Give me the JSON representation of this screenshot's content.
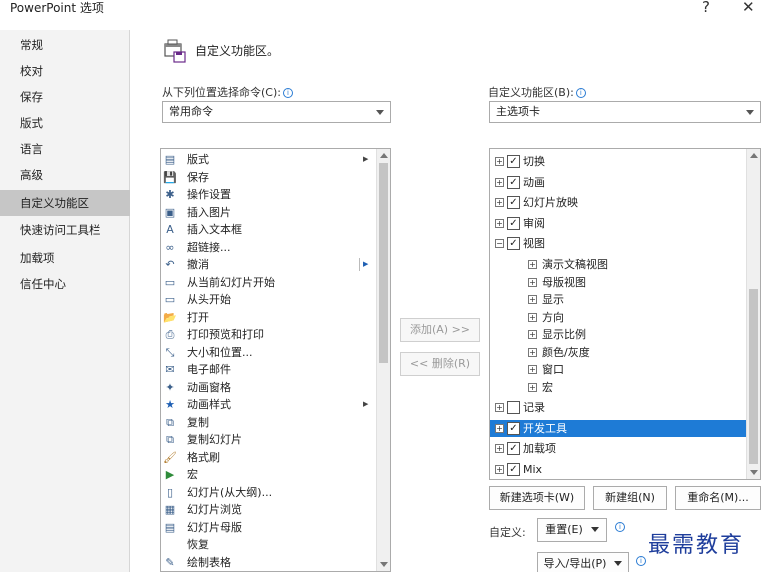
{
  "window": {
    "title": "PowerPoint 选项",
    "help_glyph": "?",
    "close_glyph": "✕"
  },
  "sidebar": {
    "items": [
      {
        "label": "常规",
        "selected": false
      },
      {
        "label": "校对",
        "selected": false
      },
      {
        "label": "保存",
        "selected": false
      },
      {
        "label": "版式",
        "selected": false
      },
      {
        "label": "语言",
        "selected": false
      },
      {
        "label": "高级",
        "selected": false
      },
      {
        "label": "自定义功能区",
        "selected": true
      },
      {
        "label": "快速访问工具栏",
        "selected": false
      },
      {
        "label": "加载项",
        "selected": false
      },
      {
        "label": "信任中心",
        "selected": false
      }
    ]
  },
  "header": {
    "title": "自定义功能区。",
    "icon": "customize-ribbon-icon"
  },
  "left_panel": {
    "label": "从下列位置选择命令(C):",
    "dropdown_value": "常用命令",
    "commands": [
      {
        "label": "版式",
        "icon": "layout-icon",
        "glyph": "▤",
        "submenu": true
      },
      {
        "label": "保存",
        "icon": "save-icon",
        "glyph": "💾",
        "submenu": false
      },
      {
        "label": "操作设置",
        "icon": "action-icon",
        "glyph": "✱",
        "submenu": false
      },
      {
        "label": "插入图片",
        "icon": "picture-icon",
        "glyph": "▣",
        "submenu": false
      },
      {
        "label": "插入文本框",
        "icon": "textbox-icon",
        "glyph": "A",
        "submenu": false
      },
      {
        "label": "超链接...",
        "icon": "link-icon",
        "glyph": "∞",
        "submenu": false
      },
      {
        "label": "撤消",
        "icon": "undo-icon",
        "glyph": "↶",
        "submenu": true,
        "split": true
      },
      {
        "label": "从当前幻灯片开始",
        "icon": "slideshow-current-icon",
        "glyph": "▭",
        "submenu": false
      },
      {
        "label": "从头开始",
        "icon": "slideshow-start-icon",
        "glyph": "▭",
        "submenu": false
      },
      {
        "label": "打开",
        "icon": "open-folder-icon",
        "glyph": "📂",
        "submenu": false
      },
      {
        "label": "打印预览和打印",
        "icon": "print-preview-icon",
        "glyph": "⎙",
        "submenu": false
      },
      {
        "label": "大小和位置...",
        "icon": "size-position-icon",
        "glyph": "⤡",
        "submenu": false
      },
      {
        "label": "电子邮件",
        "icon": "email-icon",
        "glyph": "✉",
        "submenu": false
      },
      {
        "label": "动画窗格",
        "icon": "animation-pane-icon",
        "glyph": "✦",
        "submenu": false
      },
      {
        "label": "动画样式",
        "icon": "animation-style-icon",
        "glyph": "★",
        "submenu": true
      },
      {
        "label": "复制",
        "icon": "copy-icon",
        "glyph": "⧉",
        "submenu": false
      },
      {
        "label": "复制幻灯片",
        "icon": "duplicate-slide-icon",
        "glyph": "⧉",
        "submenu": false
      },
      {
        "label": "格式刷",
        "icon": "format-painter-icon",
        "glyph": "🖌",
        "submenu": false
      },
      {
        "label": "宏",
        "icon": "macro-icon",
        "glyph": "▶",
        "submenu": false
      },
      {
        "label": "幻灯片(从大纲)...",
        "icon": "slides-outline-icon",
        "glyph": "▯",
        "submenu": false
      },
      {
        "label": "幻灯片浏览",
        "icon": "slide-sorter-icon",
        "glyph": "▦",
        "submenu": false
      },
      {
        "label": "幻灯片母版",
        "icon": "slide-master-icon",
        "glyph": "▤",
        "submenu": false
      },
      {
        "label": "恢复",
        "icon": "redo-icon",
        "glyph": "",
        "submenu": false
      },
      {
        "label": "绘制表格",
        "icon": "draw-table-icon",
        "glyph": "✎",
        "submenu": false
      }
    ]
  },
  "middle": {
    "add_label": "添加(A) >>",
    "remove_label": "<< 删除(R)"
  },
  "right_panel": {
    "label": "自定义功能区(B):",
    "dropdown_value": "主选项卡",
    "tree": [
      {
        "label": "切换",
        "level": 0,
        "expander": "+",
        "checked": true,
        "highlighted": false
      },
      {
        "label": "动画",
        "level": 0,
        "expander": "+",
        "checked": true,
        "highlighted": false
      },
      {
        "label": "幻灯片放映",
        "level": 0,
        "expander": "+",
        "checked": true,
        "highlighted": false
      },
      {
        "label": "审阅",
        "level": 0,
        "expander": "+",
        "checked": true,
        "highlighted": false
      },
      {
        "label": "视图",
        "level": 0,
        "expander": "−",
        "checked": true,
        "highlighted": false
      },
      {
        "label": "演示文稿视图",
        "level": 1,
        "expander": "+",
        "checked": null,
        "highlighted": false
      },
      {
        "label": "母版视图",
        "level": 1,
        "expander": "+",
        "checked": null,
        "highlighted": false
      },
      {
        "label": "显示",
        "level": 1,
        "expander": "+",
        "checked": null,
        "highlighted": false
      },
      {
        "label": "方向",
        "level": 1,
        "expander": "+",
        "checked": null,
        "highlighted": false
      },
      {
        "label": "显示比例",
        "level": 1,
        "expander": "+",
        "checked": null,
        "highlighted": false
      },
      {
        "label": "颜色/灰度",
        "level": 1,
        "expander": "+",
        "checked": null,
        "highlighted": false
      },
      {
        "label": "窗口",
        "level": 1,
        "expander": "+",
        "checked": null,
        "highlighted": false
      },
      {
        "label": "宏",
        "level": 1,
        "expander": "+",
        "checked": null,
        "highlighted": false
      },
      {
        "label": "记录",
        "level": 0,
        "expander": "+",
        "checked": false,
        "highlighted": false
      },
      {
        "label": "开发工具",
        "level": 0,
        "expander": "+",
        "checked": true,
        "highlighted": true
      },
      {
        "label": "加载项",
        "level": 0,
        "expander": "+",
        "checked": true,
        "highlighted": false
      },
      {
        "label": "Mix",
        "level": 0,
        "expander": "+",
        "checked": true,
        "highlighted": false
      }
    ]
  },
  "bottom": {
    "new_tab_label": "新建选项卡(W)",
    "new_group_label": "新建组(N)",
    "rename_label": "重命名(M)...",
    "customize_label": "自定义:",
    "reset_label": "重置(E)",
    "import_export_label": "导入/导出(P)"
  },
  "watermark": "最需教育",
  "colors": {
    "highlight": "#1e7bd6",
    "sidebar_selected": "#c6c6c6",
    "sidebar_bg": "#f3f3f3",
    "info_icon": "#2b7cd3"
  }
}
